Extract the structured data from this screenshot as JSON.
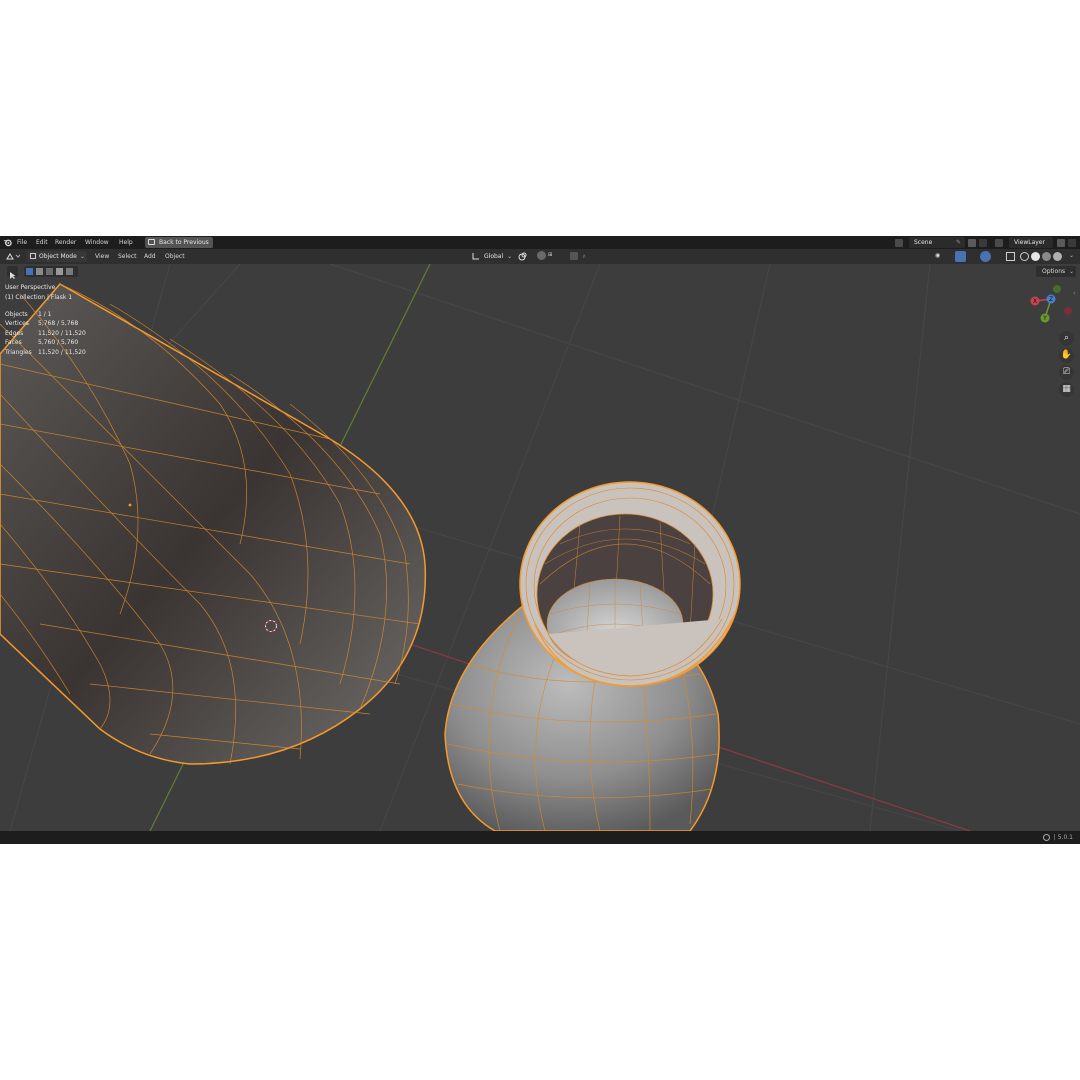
{
  "menubar": {
    "items": [
      "File",
      "Edit",
      "Render",
      "Window",
      "Help"
    ],
    "back_button": "Back to Previous",
    "scene_name": "Scene",
    "view_layer": "ViewLayer"
  },
  "header": {
    "mode": "Object Mode",
    "menus": [
      "View",
      "Select",
      "Add",
      "Object"
    ],
    "transform_orientation": "Global"
  },
  "viewport": {
    "perspective_label": "User Perspective",
    "collection_label": "(1) Collection | Flask 1",
    "stats": [
      {
        "label": "Objects",
        "value": "1 / 1"
      },
      {
        "label": "Vertices",
        "value": "5,768 / 5,768"
      },
      {
        "label": "Edges",
        "value": "11,520 / 11,520"
      },
      {
        "label": "Faces",
        "value": "5,760 / 5,760"
      },
      {
        "label": "Triangles",
        "value": "11,520 / 11,520"
      }
    ],
    "options_button": "Options",
    "gizmo": {
      "x": "X",
      "y": "Y",
      "z": "Z"
    }
  },
  "statusbar": {
    "version": "5.0.1"
  },
  "colors": {
    "selection_wire": "#f59a2e",
    "axis_x": "#b33b4a",
    "axis_y": "#6a9a2d",
    "background": "#3d3d3d"
  }
}
